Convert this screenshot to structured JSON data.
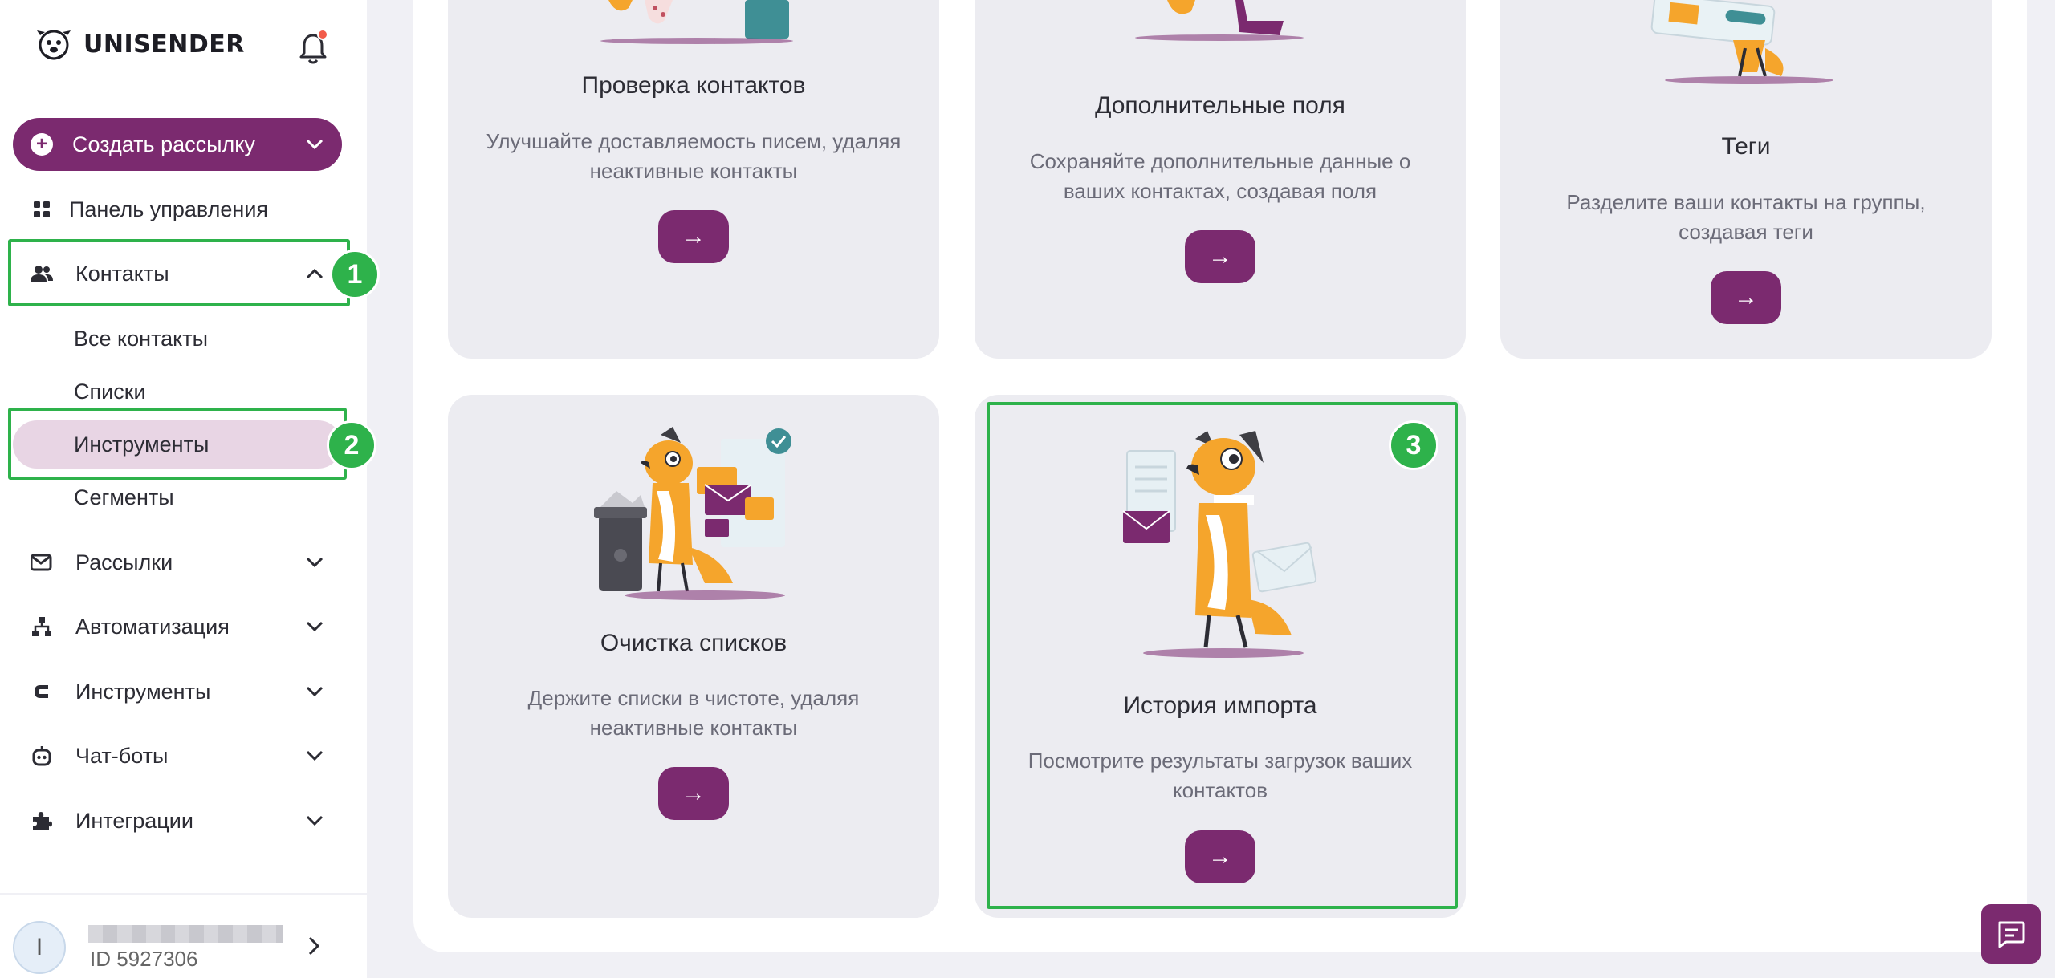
{
  "brand": {
    "name": "UNISENDER",
    "accent": "#7b2a6f",
    "highlight": "#2eb24b"
  },
  "sidebar": {
    "create_button": "Создать рассылку",
    "dashboard": "Панель управления",
    "contacts": "Контакты",
    "contacts_sub": [
      "Все контакты",
      "Списки",
      "Инструменты",
      "Сегменты"
    ],
    "items": [
      {
        "label": "Рассылки",
        "icon": "mail-icon"
      },
      {
        "label": "Автоматизация",
        "icon": "hierarchy-icon"
      },
      {
        "label": "Инструменты",
        "icon": "magnet-icon"
      },
      {
        "label": "Чат-боты",
        "icon": "robot-icon"
      },
      {
        "label": "Интеграции",
        "icon": "puzzle-icon"
      }
    ],
    "user": {
      "avatar_letter": "I",
      "id": "ID 5927306"
    }
  },
  "annotations": [
    "1",
    "2",
    "3"
  ],
  "cards": [
    {
      "title": "Проверка контактов",
      "desc": "Улучшайте доставляемость писем, удаляя неактивные контакты",
      "button": "→"
    },
    {
      "title": "Дополнительные поля",
      "desc": "Сохраняйте дополнительные данные о ваших контактах, создавая поля",
      "button": "→"
    },
    {
      "title": "Теги",
      "desc": "Разделите ваши контакты на группы, создавая теги",
      "button": "→"
    },
    {
      "title": "Очистка списков",
      "desc": "Держите списки в чистоте, удаляя неактивные контакты",
      "button": "→"
    },
    {
      "title": "История импорта",
      "desc": "Посмотрите результаты загрузок ваших контактов",
      "button": "→"
    }
  ]
}
